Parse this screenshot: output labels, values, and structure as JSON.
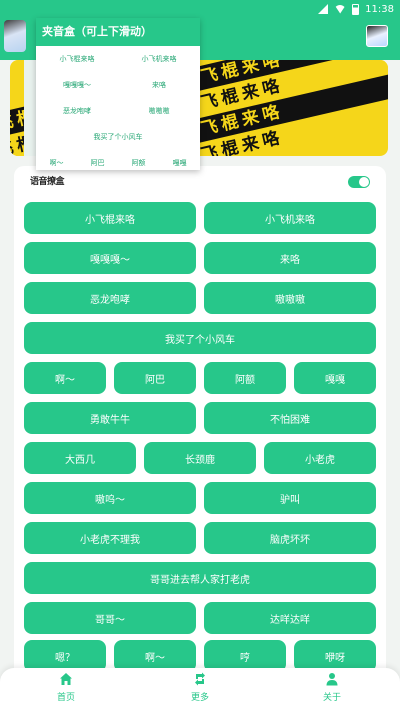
{
  "status_bar": {
    "time": "11:38"
  },
  "panel": {
    "title": "夹音盒（可上下滑动）",
    "rows": [
      [
        "小飞棍来咯",
        "小飞机来咯"
      ],
      [
        "嘎嘎嘎～",
        "来咯"
      ],
      [
        "恶龙咆哮",
        "嗷嗷嗷"
      ],
      [
        "我买了个小风车"
      ],
      [
        "啊～",
        "阿巴",
        "阿额",
        "嘎嘎"
      ]
    ]
  },
  "banner": {
    "text": "小飞棍来咯小飞棍来咯小飞棍来咯"
  },
  "card": {
    "logo_text": "语音撩盒"
  },
  "buttons": [
    "小飞棍来咯",
    "小飞机来咯",
    "嘎嘎嘎～",
    "来咯",
    "恶龙咆哮",
    "嗷嗷嗷",
    "我买了个小风车",
    "啊～",
    "阿巴",
    "阿额",
    "嘎嘎",
    "勇敢牛牛",
    "不怕困难",
    "大西几",
    "长颈鹿",
    "小老虎",
    "嗷呜～",
    "驴叫",
    "小老虎不理我",
    "脑虎坏坏",
    "哥哥进去帮人家打老虎",
    "哥哥～",
    "达咩达咩",
    "嗯？",
    "啊～",
    "哼",
    "咿呀"
  ],
  "nav": {
    "home": "首页",
    "more": "更多",
    "about": "关于"
  },
  "colors": {
    "accent": "#27c78a",
    "banner_yellow": "#f5d61a"
  }
}
